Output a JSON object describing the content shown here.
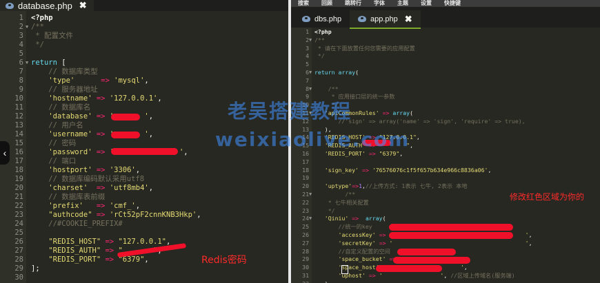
{
  "left": {
    "tab": {
      "title": "database.php",
      "close": "✖"
    },
    "lines": [
      {
        "n": "1",
        "seg": [
          [
            "php",
            "<?php"
          ]
        ]
      },
      {
        "n": "2",
        "fold": "▼",
        "seg": [
          [
            "com",
            "/**"
          ]
        ]
      },
      {
        "n": "3",
        "seg": [
          [
            "com",
            " * 配置文件"
          ]
        ]
      },
      {
        "n": "4",
        "seg": [
          [
            "com",
            " */"
          ]
        ]
      },
      {
        "n": "5",
        "seg": []
      },
      {
        "n": "6",
        "fold": "▼",
        "seg": [
          [
            "ret",
            "return"
          ],
          [
            "plain",
            " ["
          ]
        ]
      },
      {
        "n": "7",
        "seg": [
          [
            "com",
            "    // 数据库类型"
          ]
        ]
      },
      {
        "n": "8",
        "seg": [
          [
            "plain",
            "    "
          ],
          [
            "str",
            "'type'"
          ],
          [
            "plain",
            "      "
          ],
          [
            "kw",
            "=>"
          ],
          [
            "plain",
            " "
          ],
          [
            "str",
            "'mysql'"
          ],
          [
            "plain",
            ","
          ]
        ]
      },
      {
        "n": "9",
        "seg": [
          [
            "com",
            "    // 服务器地址"
          ]
        ]
      },
      {
        "n": "10",
        "seg": [
          [
            "plain",
            "    "
          ],
          [
            "str",
            "'hostname'"
          ],
          [
            "plain",
            " "
          ],
          [
            "kw",
            "=>"
          ],
          [
            "plain",
            " "
          ],
          [
            "str",
            "'127.0.0.1'"
          ],
          [
            "plain",
            ","
          ]
        ]
      },
      {
        "n": "11",
        "seg": [
          [
            "com",
            "    // 数据库名"
          ]
        ]
      },
      {
        "n": "12",
        "seg": [
          [
            "plain",
            "    "
          ],
          [
            "str",
            "'database'"
          ],
          [
            "plain",
            " "
          ],
          [
            "kw",
            "=>"
          ],
          [
            "plain",
            " "
          ],
          [
            "str",
            "'       '"
          ],
          [
            "plain",
            ","
          ]
        ]
      },
      {
        "n": "13",
        "seg": [
          [
            "com",
            "    // 用户名"
          ]
        ]
      },
      {
        "n": "14",
        "seg": [
          [
            "plain",
            "    "
          ],
          [
            "str",
            "'username'"
          ],
          [
            "plain",
            " "
          ],
          [
            "kw",
            "=>"
          ],
          [
            "plain",
            " "
          ],
          [
            "str",
            "'       '"
          ],
          [
            "plain",
            ","
          ]
        ]
      },
      {
        "n": "15",
        "seg": [
          [
            "com",
            "    // 密码"
          ]
        ]
      },
      {
        "n": "16",
        "seg": [
          [
            "plain",
            "    "
          ],
          [
            "str",
            "'password'"
          ],
          [
            "plain",
            " "
          ],
          [
            "kw",
            "=>"
          ],
          [
            "plain",
            " "
          ],
          [
            "str",
            "'               '"
          ],
          [
            "plain",
            ","
          ]
        ]
      },
      {
        "n": "17",
        "seg": [
          [
            "com",
            "    // 端口"
          ]
        ]
      },
      {
        "n": "18",
        "seg": [
          [
            "plain",
            "    "
          ],
          [
            "str",
            "'hostport'"
          ],
          [
            "plain",
            " "
          ],
          [
            "kw",
            "=>"
          ],
          [
            "plain",
            " "
          ],
          [
            "str",
            "'3306'"
          ],
          [
            "plain",
            ","
          ]
        ]
      },
      {
        "n": "19",
        "seg": [
          [
            "com",
            "    // 数据库编码默认采用utf8"
          ]
        ]
      },
      {
        "n": "20",
        "seg": [
          [
            "plain",
            "    "
          ],
          [
            "str",
            "'charset'"
          ],
          [
            "plain",
            "  "
          ],
          [
            "kw",
            "=>"
          ],
          [
            "plain",
            " "
          ],
          [
            "str",
            "'utf8mb4'"
          ],
          [
            "plain",
            ","
          ]
        ]
      },
      {
        "n": "21",
        "seg": [
          [
            "com",
            "    // 数据库表前缀"
          ]
        ]
      },
      {
        "n": "22",
        "seg": [
          [
            "plain",
            "    "
          ],
          [
            "str",
            "'prefix'"
          ],
          [
            "plain",
            "   "
          ],
          [
            "kw",
            "=>"
          ],
          [
            "plain",
            " "
          ],
          [
            "str",
            "'cmf_'"
          ],
          [
            "plain",
            ","
          ]
        ]
      },
      {
        "n": "23",
        "seg": [
          [
            "plain",
            "    "
          ],
          [
            "str",
            "\"authcode\""
          ],
          [
            "plain",
            " "
          ],
          [
            "kw",
            "=>"
          ],
          [
            "plain",
            " "
          ],
          [
            "str",
            "'rCt52pF2cnnKNB3Hkp'"
          ],
          [
            "plain",
            ","
          ]
        ]
      },
      {
        "n": "24",
        "seg": [
          [
            "com",
            "    //#COOKIE_PREFIX#"
          ]
        ]
      },
      {
        "n": "25",
        "seg": []
      },
      {
        "n": "26",
        "seg": [
          [
            "plain",
            "    "
          ],
          [
            "str",
            "\"REDIS_HOST\""
          ],
          [
            "plain",
            " "
          ],
          [
            "kw",
            "=>"
          ],
          [
            "plain",
            " "
          ],
          [
            "str",
            "\"127.0.0.1\""
          ],
          [
            "plain",
            ","
          ]
        ]
      },
      {
        "n": "27",
        "seg": [
          [
            "plain",
            "    "
          ],
          [
            "str",
            "\"REDIS_AUTH\""
          ],
          [
            "plain",
            " "
          ],
          [
            "kw",
            "=>"
          ],
          [
            "plain",
            " "
          ],
          [
            "str",
            "\"       \""
          ],
          [
            "plain",
            ","
          ]
        ]
      },
      {
        "n": "28",
        "seg": [
          [
            "plain",
            "    "
          ],
          [
            "str",
            "\"REDIS_PORT\""
          ],
          [
            "plain",
            " "
          ],
          [
            "kw",
            "=>"
          ],
          [
            "plain",
            " "
          ],
          [
            "str",
            "\"6379\""
          ],
          [
            "plain",
            ","
          ]
        ]
      },
      {
        "n": "29",
        "seg": [
          [
            "plain",
            "];"
          ]
        ]
      },
      {
        "n": "30",
        "seg": []
      }
    ],
    "annotation": "Redis密码"
  },
  "right": {
    "toolbar": [
      "搜索",
      "回顾",
      "跳转行",
      "字体",
      "主题",
      "设置",
      "快捷键"
    ],
    "tabs": [
      {
        "title": "dbs.php"
      },
      {
        "title": "app.php",
        "close": "✖"
      }
    ],
    "lines": [
      {
        "n": "1",
        "seg": [
          [
            "php",
            "<?php"
          ]
        ]
      },
      {
        "n": "2",
        "fold": "▼",
        "seg": [
          [
            "com",
            "/**"
          ]
        ]
      },
      {
        "n": "3",
        "seg": [
          [
            "com",
            " * 请在下面放置任何您需要的应用配置"
          ]
        ]
      },
      {
        "n": "4",
        "seg": [
          [
            "com",
            " */"
          ]
        ]
      },
      {
        "n": "5",
        "seg": []
      },
      {
        "n": "6",
        "fold": "▼",
        "seg": [
          [
            "ret",
            "return"
          ],
          [
            "plain",
            " "
          ],
          [
            "fn",
            "array"
          ],
          [
            "plain",
            "("
          ]
        ]
      },
      {
        "n": "7",
        "seg": []
      },
      {
        "n": "8",
        "fold": "▼",
        "seg": [
          [
            "com",
            "    /**"
          ]
        ]
      },
      {
        "n": "9",
        "seg": [
          [
            "com",
            "     * 应用接口层的统一参数"
          ]
        ]
      },
      {
        "n": "10",
        "seg": [
          [
            "com",
            "     */"
          ]
        ]
      },
      {
        "n": "11",
        "fold": "▼",
        "seg": [
          [
            "plain",
            "   "
          ],
          [
            "str",
            "'apiCommonRules'"
          ],
          [
            "plain",
            " "
          ],
          [
            "kw",
            "=>"
          ],
          [
            "plain",
            " "
          ],
          [
            "fn",
            "array"
          ],
          [
            "plain",
            "("
          ]
        ]
      },
      {
        "n": "12",
        "seg": [
          [
            "com",
            "       //'sign' => array('name' => 'sign', 'require' => true),"
          ]
        ]
      },
      {
        "n": "13",
        "seg": [
          [
            "plain",
            "   ),"
          ]
        ]
      },
      {
        "n": "14",
        "seg": [
          [
            "plain",
            "   "
          ],
          [
            "str",
            "'REDIS_HOST'"
          ],
          [
            "plain",
            " "
          ],
          [
            "kw",
            "=>"
          ],
          [
            "plain",
            " "
          ],
          [
            "str",
            "\"127.0.0.1\""
          ],
          [
            "plain",
            ","
          ]
        ]
      },
      {
        "n": "15",
        "seg": [
          [
            "plain",
            "   "
          ],
          [
            "str",
            "'REDIS_AUTH'"
          ],
          [
            "plain",
            " "
          ],
          [
            "kw",
            "=>"
          ],
          [
            "plain",
            " "
          ],
          [
            "str",
            "\"       \""
          ],
          [
            "plain",
            ","
          ]
        ]
      },
      {
        "n": "16",
        "seg": [
          [
            "plain",
            "   "
          ],
          [
            "str",
            "'REDIS_PORT'"
          ],
          [
            "plain",
            " "
          ],
          [
            "kw",
            "=>"
          ],
          [
            "plain",
            " "
          ],
          [
            "str",
            "\"6379\""
          ],
          [
            "plain",
            ","
          ]
        ]
      },
      {
        "n": "17",
        "seg": []
      },
      {
        "n": "18",
        "seg": [
          [
            "plain",
            "   "
          ],
          [
            "str",
            "'sign_key'"
          ],
          [
            "plain",
            " "
          ],
          [
            "kw",
            "=>"
          ],
          [
            "plain",
            " "
          ],
          [
            "str",
            "'76576076c1f5f657b634e966c8836a06'"
          ],
          [
            "plain",
            ","
          ]
        ]
      },
      {
        "n": "19",
        "seg": []
      },
      {
        "n": "20",
        "seg": [
          [
            "plain",
            "   "
          ],
          [
            "str",
            "'uptype'"
          ],
          [
            "kw",
            "=>"
          ],
          [
            "num",
            "1"
          ],
          [
            "plain",
            ","
          ],
          [
            "com",
            "//上传方式: 1表示 七牛, 2表示 本地"
          ]
        ]
      },
      {
        "n": "21",
        "fold": "▼",
        "seg": [
          [
            "com",
            "         /**"
          ]
        ]
      },
      {
        "n": "22",
        "seg": [
          [
            "com",
            "    * 七牛相关配置"
          ]
        ]
      },
      {
        "n": "23",
        "seg": [
          [
            "com",
            "    */"
          ]
        ]
      },
      {
        "n": "24",
        "fold": "▼",
        "seg": [
          [
            "plain",
            "   "
          ],
          [
            "str",
            "'Qiniu'"
          ],
          [
            "plain",
            " "
          ],
          [
            "kw",
            "=>"
          ],
          [
            "plain",
            "  "
          ],
          [
            "fn",
            "array"
          ],
          [
            "plain",
            "("
          ]
        ]
      },
      {
        "n": "25",
        "seg": [
          [
            "com",
            "       //统一的key"
          ]
        ]
      },
      {
        "n": "26",
        "seg": [
          [
            "plain",
            "       "
          ],
          [
            "str",
            "'accessKey'"
          ],
          [
            "plain",
            " "
          ],
          [
            "kw",
            "=>"
          ],
          [
            "plain",
            " "
          ],
          [
            "str",
            "'                                       '"
          ],
          [
            "plain",
            ","
          ]
        ]
      },
      {
        "n": "27",
        "seg": [
          [
            "plain",
            "       "
          ],
          [
            "str",
            "'secretKey'"
          ],
          [
            "plain",
            " "
          ],
          [
            "kw",
            "=>"
          ],
          [
            "plain",
            " "
          ],
          [
            "str",
            "'                                       '"
          ],
          [
            "plain",
            ","
          ]
        ]
      },
      {
        "n": "28",
        "seg": [
          [
            "com",
            "       //自定义配置的空间"
          ]
        ]
      },
      {
        "n": "29",
        "seg": [
          [
            "plain",
            "       "
          ],
          [
            "str",
            "'space_bucket'"
          ],
          [
            "plain",
            " "
          ],
          [
            "kw",
            "=>"
          ],
          [
            "plain",
            " "
          ],
          [
            "str",
            "'                '"
          ],
          [
            "plain",
            ","
          ]
        ]
      },
      {
        "n": "30",
        "seg": [
          [
            "plain",
            "       "
          ],
          [
            "str",
            "'space_host'"
          ],
          [
            "plain",
            " "
          ],
          [
            "kw",
            "=>"
          ],
          [
            "plain",
            " "
          ],
          [
            "str",
            "'                   '"
          ],
          [
            "plain",
            ","
          ]
        ]
      },
      {
        "n": "31",
        "seg": [
          [
            "plain",
            "       "
          ],
          [
            "str",
            "'uphost'"
          ],
          [
            "plain",
            " "
          ],
          [
            "kw",
            "=>"
          ],
          [
            "plain",
            " "
          ],
          [
            "str",
            "'                 '"
          ],
          [
            "plain",
            ", "
          ],
          [
            "com",
            "//区域上传域名(服务端)"
          ]
        ]
      },
      {
        "n": "32",
        "seg": [
          [
            "plain",
            "   ),"
          ]
        ]
      }
    ],
    "annotation": "修改红色区域为你的"
  },
  "watermark": {
    "line1": "老吴搭建教程",
    "line2": "weixiaolive.com"
  }
}
